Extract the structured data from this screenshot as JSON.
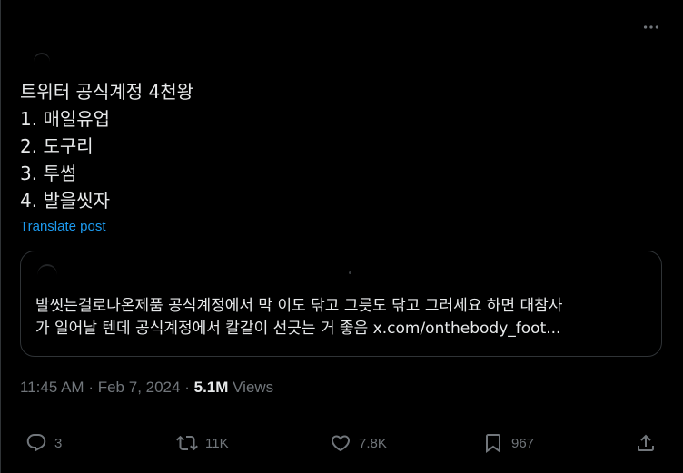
{
  "tweet": {
    "lines": [
      "트위터 공식계정 4천왕",
      "1. 매일유업",
      "2. 도구리",
      "3. 투썸",
      "4. 발을씻자"
    ],
    "translate_label": "Translate post"
  },
  "quote": {
    "lines": [
      "발씻는걸로나온제품 공식계정에서 막 이도 닦고 그릇도 닦고 그러세요 하면 대참사",
      "가 일어날 텐데 공식계정에서 칼같이 선긋는 거 좋음 x.com/onthebody_foot..."
    ]
  },
  "meta": {
    "time": "11:45 AM",
    "separator": "·",
    "date": "Feb 7, 2024",
    "views_count": "5.1M",
    "views_label": "Views"
  },
  "actions": {
    "replies": "3",
    "reposts": "11K",
    "likes": "7.8K",
    "bookmarks": "967"
  },
  "colors": {
    "background": "#000000",
    "text": "#e7e9ea",
    "muted": "#71767b",
    "accent": "#1d9bf0",
    "border": "#2f3336"
  },
  "icons": {
    "more": "more-horizontal-icon",
    "reply": "reply-icon",
    "repost": "repost-icon",
    "like": "like-icon",
    "bookmark": "bookmark-icon",
    "share": "share-icon"
  }
}
